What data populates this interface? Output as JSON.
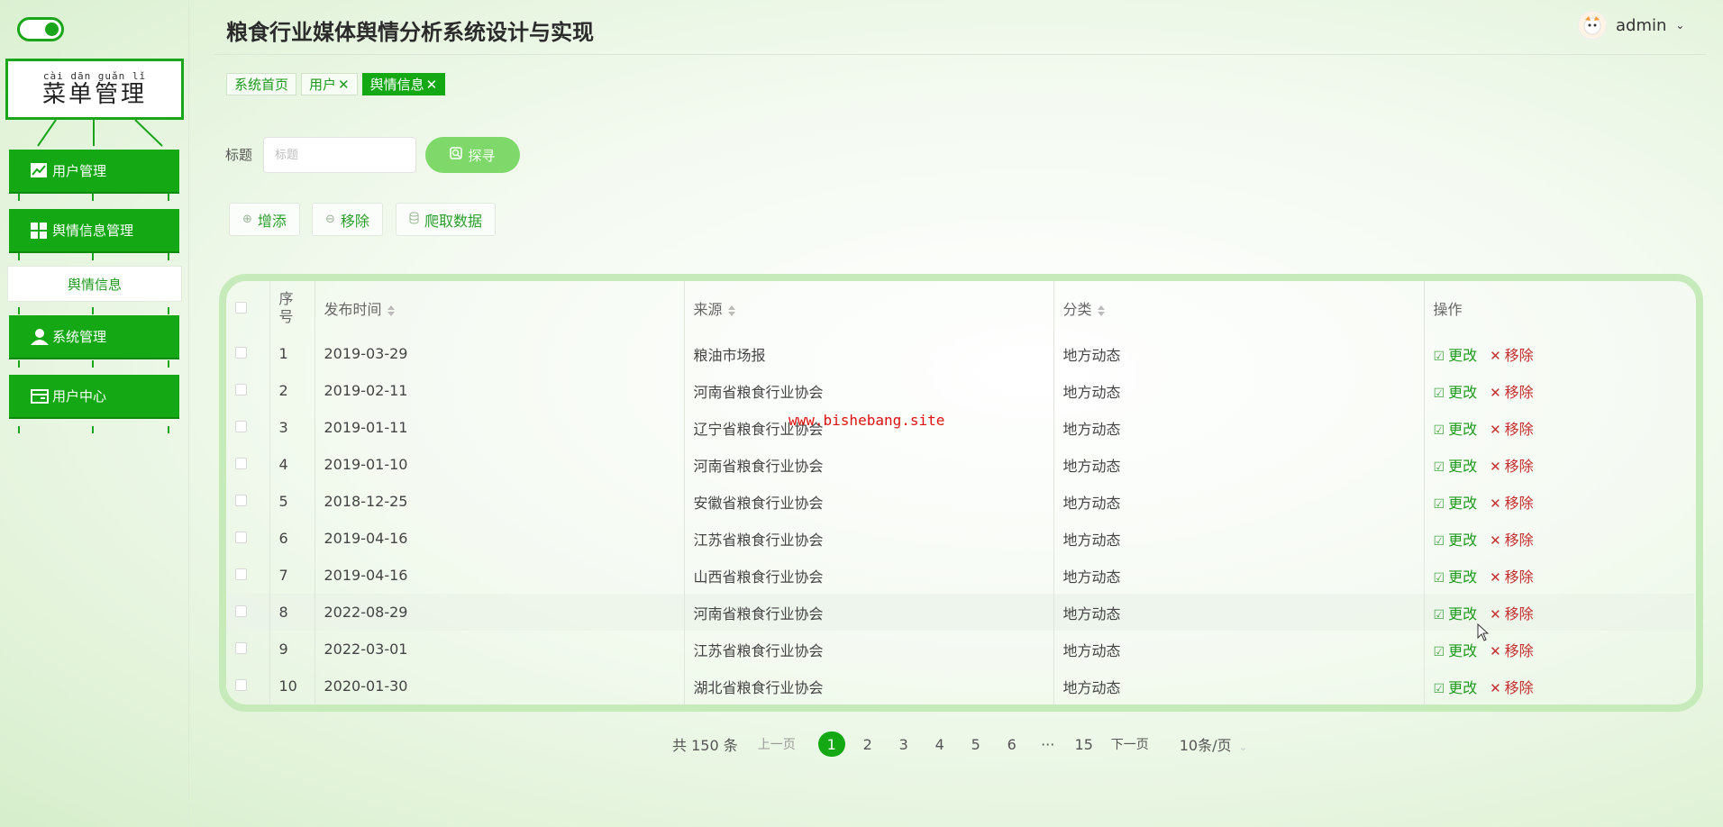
{
  "sidebar": {
    "menu_title_pinyin": "cài dān guǎn lǐ",
    "menu_title": "菜单管理",
    "items": [
      {
        "label": "用户管理",
        "icon": "chart-icon"
      },
      {
        "label": "舆情信息管理",
        "icon": "grid-icon"
      },
      {
        "label": "系统管理",
        "icon": "user-icon"
      },
      {
        "label": "用户中心",
        "icon": "card-icon"
      }
    ],
    "sub_item": "舆情信息",
    "accent_color": "#15a815"
  },
  "header": {
    "title": "粮食行业媒体舆情分析系统设计与实现",
    "username": "admin"
  },
  "tags": [
    {
      "label": "系统首页",
      "closable": false,
      "active": false
    },
    {
      "label": "用户",
      "closable": true,
      "active": false
    },
    {
      "label": "舆情信息",
      "closable": true,
      "active": true
    }
  ],
  "search": {
    "label": "标题",
    "placeholder": "标题",
    "button": "探寻"
  },
  "actions": {
    "add": "增添",
    "remove": "移除",
    "crawl": "爬取数据"
  },
  "table": {
    "headers": {
      "index": "序号",
      "time": "发布时间",
      "source": "来源",
      "category": "分类",
      "ops": "操作"
    },
    "edit_label": "更改",
    "delete_label": "移除",
    "rows": [
      {
        "index": "1",
        "time": "2019-03-29",
        "source": "粮油市场报",
        "category": "地方动态"
      },
      {
        "index": "2",
        "time": "2019-02-11",
        "source": "河南省粮食行业协会",
        "category": "地方动态"
      },
      {
        "index": "3",
        "time": "2019-01-11",
        "source": "辽宁省粮食行业协会",
        "category": "地方动态"
      },
      {
        "index": "4",
        "time": "2019-01-10",
        "source": "河南省粮食行业协会",
        "category": "地方动态"
      },
      {
        "index": "5",
        "time": "2018-12-25",
        "source": "安徽省粮食行业协会",
        "category": "地方动态"
      },
      {
        "index": "6",
        "time": "2019-04-16",
        "source": "江苏省粮食行业协会",
        "category": "地方动态"
      },
      {
        "index": "7",
        "time": "2019-04-16",
        "source": "山西省粮食行业协会",
        "category": "地方动态"
      },
      {
        "index": "8",
        "time": "2022-08-29",
        "source": "河南省粮食行业协会",
        "category": "地方动态"
      },
      {
        "index": "9",
        "time": "2022-03-01",
        "source": "江苏省粮食行业协会",
        "category": "地方动态"
      },
      {
        "index": "10",
        "time": "2020-01-30",
        "source": "湖北省粮食行业协会",
        "category": "地方动态"
      }
    ]
  },
  "watermark": "www.bishebang.site",
  "pagination": {
    "total": "共 150 条",
    "prev": "上一页",
    "pages": [
      "1",
      "2",
      "3",
      "4",
      "5",
      "6",
      "···",
      "15"
    ],
    "current": "1",
    "next": "下一页",
    "page_size": "10条/页"
  }
}
